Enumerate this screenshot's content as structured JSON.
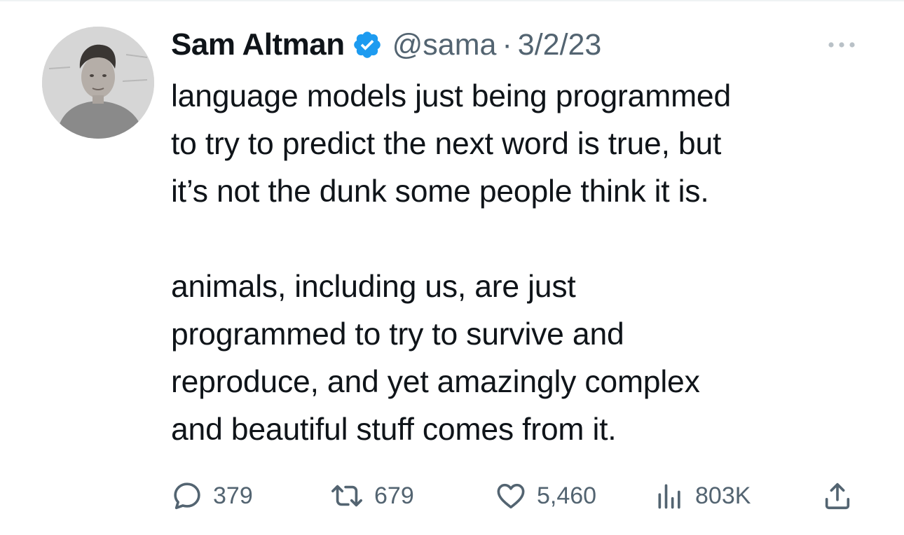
{
  "tweet": {
    "author": {
      "display_name": "Sam Altman",
      "handle": "@sama",
      "verified": true,
      "avatar_icon": "profile-photo"
    },
    "separator": "·",
    "date": "3/2/23",
    "text_paragraphs": [
      "language models just being programmed\nto try to predict the next word is true, but\nit’s not the dunk some people think it is.",
      "animals, including us, are just\nprogrammed to try to survive and\nreproduce, and yet amazingly complex\nand beautiful stuff comes from it."
    ],
    "actions": {
      "replies": "379",
      "retweets": "679",
      "likes": "5,460",
      "views": "803K"
    },
    "icons": {
      "verified": "verified-badge-icon",
      "more": "more-icon",
      "reply": "reply-icon",
      "retweet": "retweet-icon",
      "like": "heart-icon",
      "views": "views-icon",
      "share": "share-icon"
    },
    "colors": {
      "text": "#0f1419",
      "secondary": "#536471",
      "verified_blue": "#1d9bf0"
    }
  }
}
